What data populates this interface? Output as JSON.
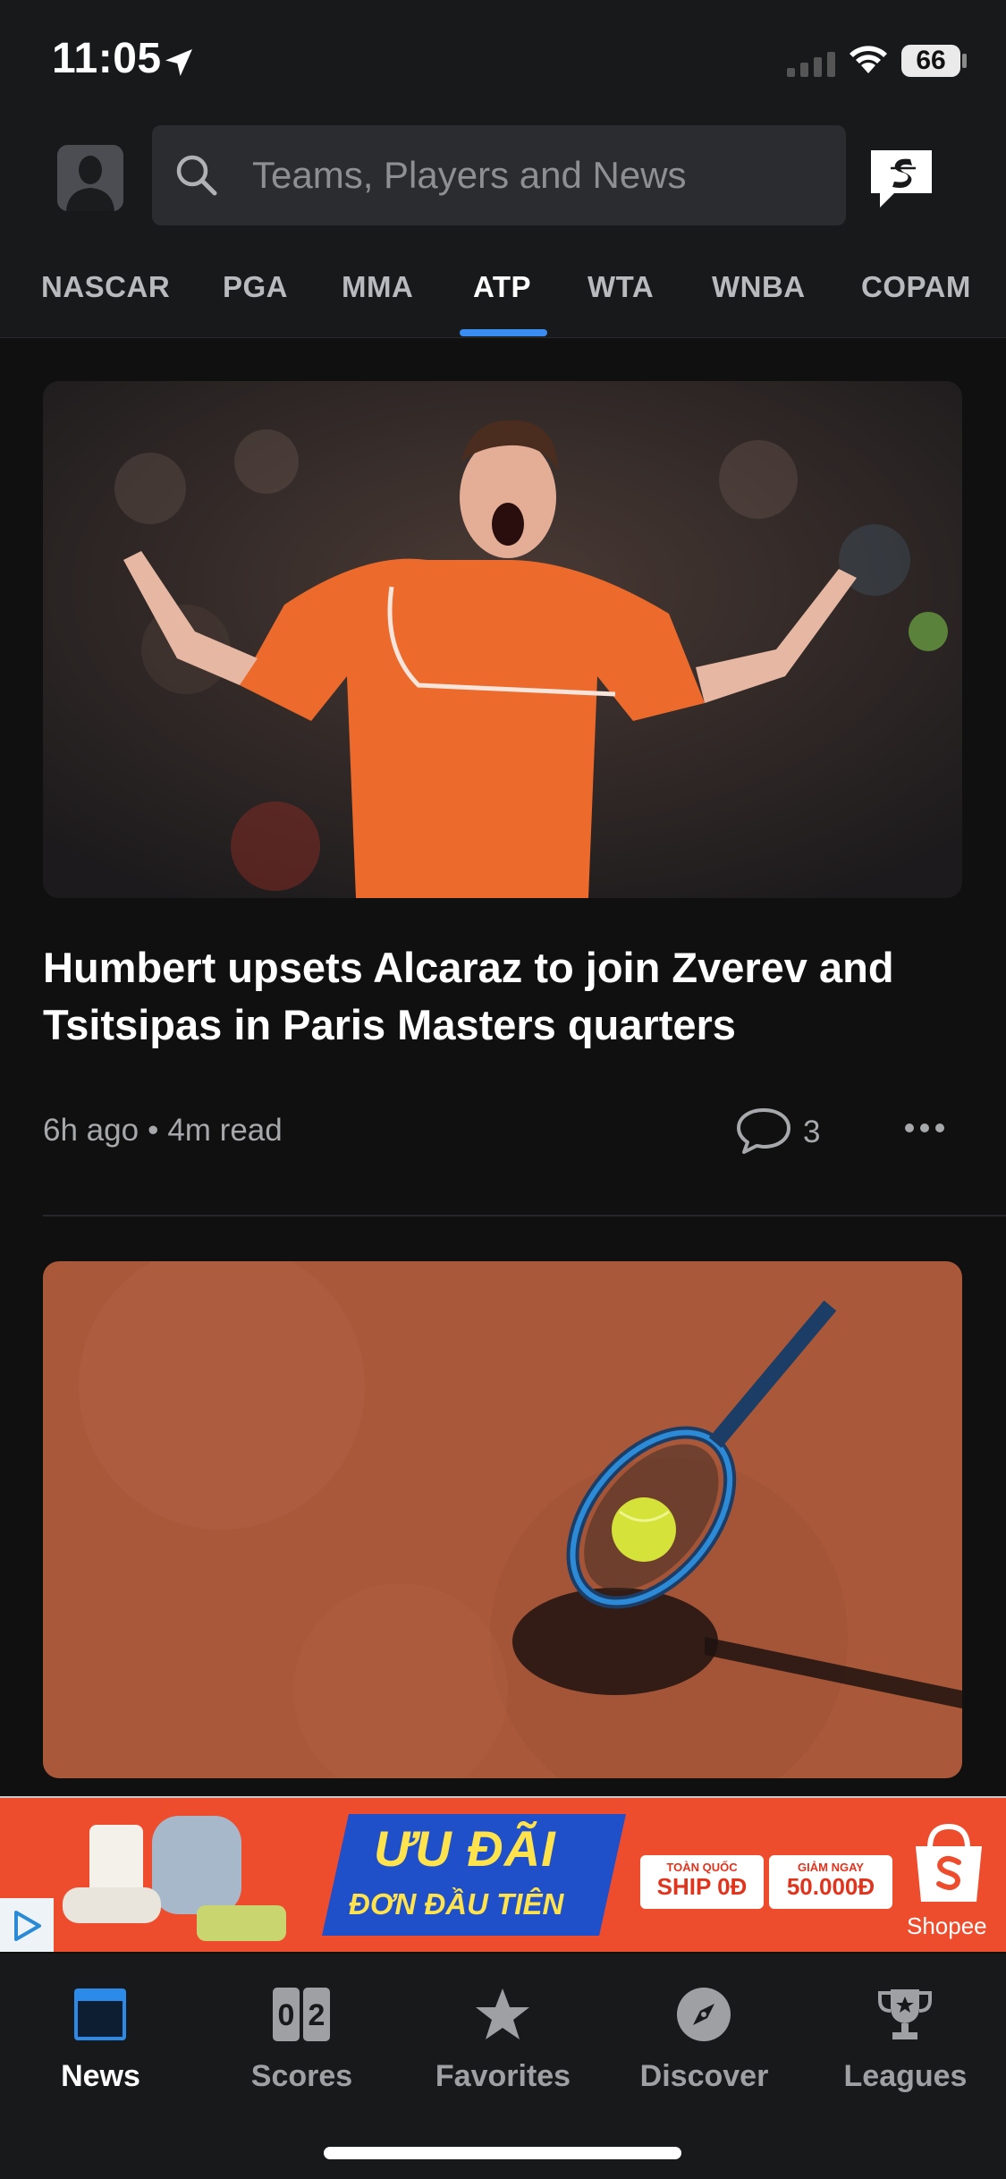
{
  "status_bar": {
    "time": "11:05",
    "battery": "66"
  },
  "header": {
    "search_placeholder": "Teams, Players and News"
  },
  "tabs": [
    {
      "label": "NASCAR",
      "active": false
    },
    {
      "label": "PGA",
      "active": false
    },
    {
      "label": "MMA",
      "active": false
    },
    {
      "label": "ATP",
      "active": true
    },
    {
      "label": "WTA",
      "active": false
    },
    {
      "label": "WNBA",
      "active": false
    },
    {
      "label": "COPAM",
      "active": false
    }
  ],
  "articles": [
    {
      "headline": "Humbert upsets Alcaraz to join Zverev and Tsitsipas in Paris Masters quarters",
      "time_ago": "6h ago",
      "read_time": "4m read",
      "comment_count": "3"
    }
  ],
  "ad": {
    "line1": "ƯU ĐÃI",
    "line2": "ĐƠN ĐẦU TIÊN",
    "promo1_small": "TOÀN QUỐC",
    "promo1_big": "SHIP 0Đ",
    "promo2_small": "GIẢM NGAY",
    "promo2_big": "50.000Đ",
    "brand": "Shopee"
  },
  "bottom_nav": [
    {
      "label": "News",
      "icon": "news-icon",
      "active": true
    },
    {
      "label": "Scores",
      "icon": "scores-icon",
      "active": false
    },
    {
      "label": "Favorites",
      "icon": "star-icon",
      "active": false
    },
    {
      "label": "Discover",
      "icon": "compass-icon",
      "active": false
    },
    {
      "label": "Leagues",
      "icon": "trophy-icon",
      "active": false
    }
  ],
  "colors": {
    "accent": "#3a8cf0",
    "background": "#101011",
    "ad_orange": "#ee4d2d"
  }
}
